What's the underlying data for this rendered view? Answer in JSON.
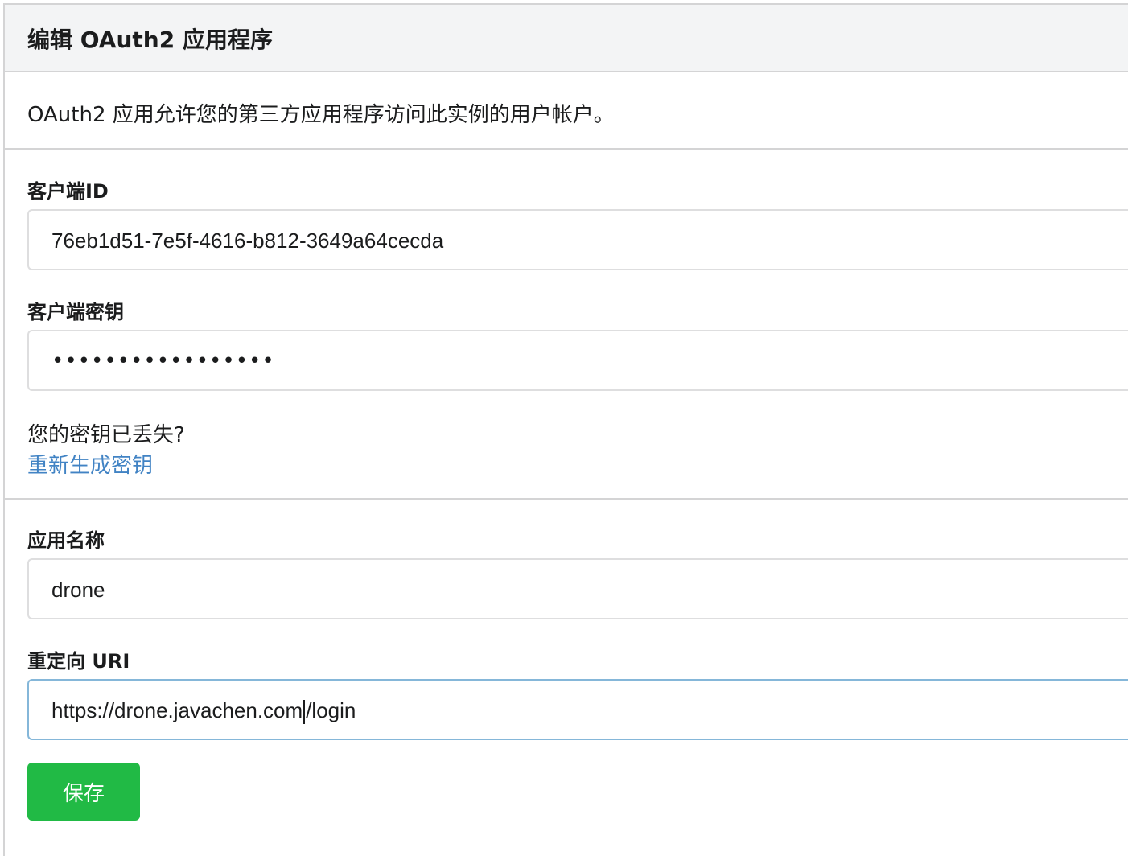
{
  "header": {
    "title": "编辑 OAuth2 应用程序"
  },
  "description": "OAuth2 应用允许您的第三方应用程序访问此实例的用户帐户。",
  "client_id": {
    "label": "客户端ID",
    "value": "76eb1d51-7e5f-4616-b812-3649a64cecda"
  },
  "client_secret": {
    "label": "客户端密钥",
    "masked_value": "•••••••••••••••••",
    "lost_prompt": "您的密钥已丢失?",
    "regenerate_link": "重新生成密钥"
  },
  "app_name": {
    "label": "应用名称",
    "value": "drone"
  },
  "redirect_uri": {
    "label": "重定向 URI",
    "value_before_cursor": "https://drone.javachen.com",
    "value_after_cursor": "/login"
  },
  "save_button": {
    "label": "保存"
  },
  "colors": {
    "header_bg": "#f3f4f5",
    "link": "#4183c4",
    "save_button_bg": "#21ba45",
    "focus_border": "#85b7d9"
  }
}
